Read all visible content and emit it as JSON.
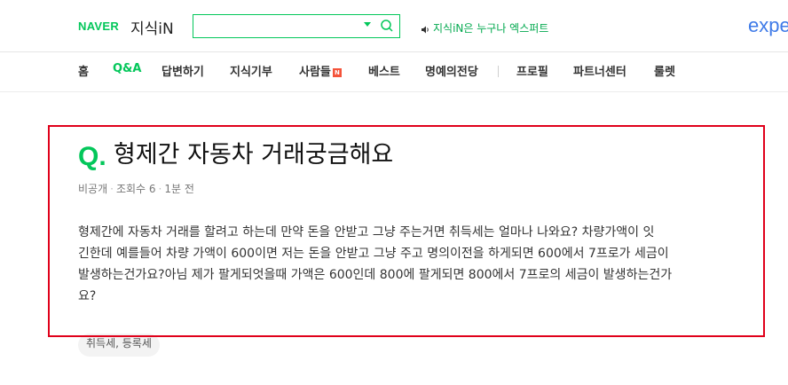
{
  "header": {
    "logo_naver": "NAVER",
    "logo_kin": "지식iN",
    "search": {
      "value": "",
      "placeholder": ""
    },
    "slogan": "지식iN은 누구나 엑스퍼트",
    "expert_text": "expe"
  },
  "nav": {
    "items": [
      {
        "label": "홈"
      },
      {
        "label": "Q&A",
        "active": true
      },
      {
        "label": "답변하기"
      },
      {
        "label": "지식기부"
      },
      {
        "label": "사람들",
        "badge": "N"
      },
      {
        "label": "베스트"
      },
      {
        "label": "명예의전당"
      },
      {
        "label": "프로필"
      },
      {
        "label": "파트너센터"
      },
      {
        "label": "룰렛"
      }
    ]
  },
  "question": {
    "q_mark": "Q.",
    "title": "형제간 자동차 거래궁금해요",
    "meta": {
      "author": "비공개",
      "views": "조회수 6",
      "time": "1분 전"
    },
    "body_lines": [
      "형제간에 자동차 거래를 할려고 하는데 만약 돈을 안받고 그냥 주는거면 취득세는 얼마나 나와요? 차량가액이 잇",
      "긴한데 예를들어 차량 가액이 600이면 저는 돈을 안받고 그냥 주고 명의이전을 하게되면 600에서 7프로가 세금이",
      "발생하는건가요?아님 제가 팔게되엇을때 가액은 600인데 800에 팔게되면 800에서 7프로의 세금이 발생하는건가",
      "요?"
    ],
    "tags": "취득세, 등록세"
  },
  "colors": {
    "brand": "#03c75a",
    "highlight": "#e0001a",
    "expert": "#3f7be8"
  },
  "icons": {
    "search": "search-icon",
    "dropdown": "chevron-down-icon",
    "speaker": "speaker-icon"
  }
}
